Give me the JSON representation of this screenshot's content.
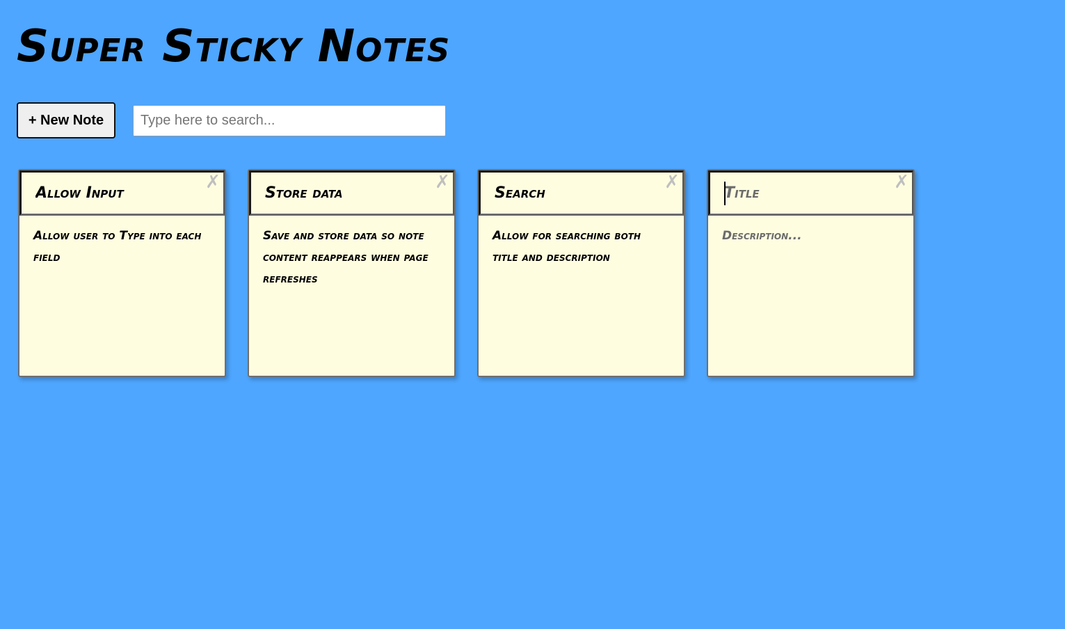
{
  "header": {
    "title": "Super Sticky Notes"
  },
  "toolbar": {
    "new_note_label": "+ New Note",
    "search_placeholder": "Type here to search...",
    "search_value": ""
  },
  "notes": [
    {
      "title": "Allow Input",
      "description": "Allow user to Type into each field",
      "delete_icon": "✗"
    },
    {
      "title": "Store data",
      "description": "Save and store data so note content reappears when page refreshes",
      "delete_icon": "✗"
    },
    {
      "title": "Search",
      "description": "Allow for searching both title and description",
      "delete_icon": "✗"
    },
    {
      "title": "",
      "title_placeholder": "Title",
      "description": "",
      "description_placeholder": "Description...",
      "delete_icon": "✗"
    }
  ],
  "colors": {
    "background": "#4ea6fe",
    "note": "#fffde0",
    "delete_icon": "#bfbfbf"
  }
}
